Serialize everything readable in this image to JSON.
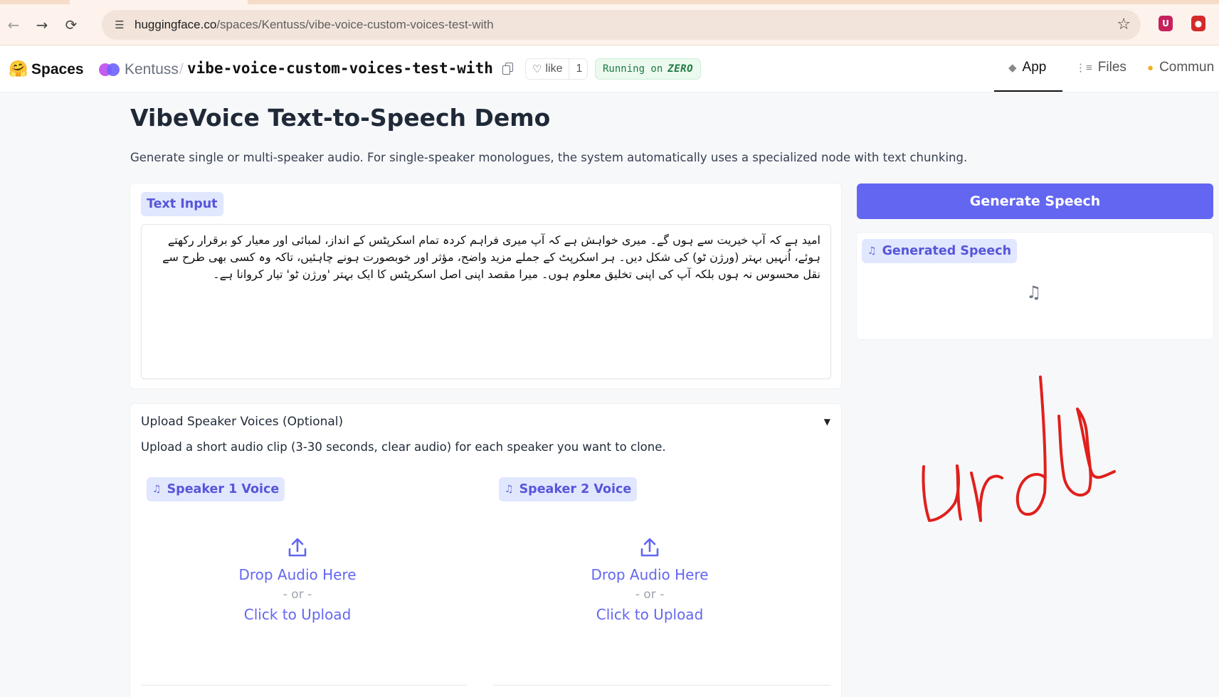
{
  "browser": {
    "url_host": "huggingface.co",
    "url_path": "/spaces/Kentuss/vibe-voice-custom-voices-test-with",
    "back_icon": "arrow-left",
    "forward_icon": "arrow-right",
    "reload_icon": "reload",
    "site_info_icon": "tune",
    "bookmark_icon": "star-outline",
    "extensions": [
      "ublock-shield",
      "security-shield"
    ]
  },
  "header": {
    "spaces_label": "Spaces",
    "owner": "Kentuss",
    "separator": "/",
    "repo": "vibe-voice-custom-voices-test-with",
    "like_label": "like",
    "like_count": "1",
    "running_prefix": "Running on",
    "running_hw": "ZERO",
    "tabs": [
      {
        "label": "App",
        "icon": "cube",
        "active": true
      },
      {
        "label": "Files",
        "icon": "files",
        "active": false
      },
      {
        "label": "Commun",
        "icon": "community",
        "active": false
      }
    ]
  },
  "page": {
    "title": "VibeVoice Text-to-Speech Demo",
    "subtitle": "Generate single or multi-speaker audio. For single-speaker monologues, the system automatically uses a specialized node with text chunking."
  },
  "text_input": {
    "label": "Text Input",
    "value": "امید ہے کہ آپ خیریت سے ہوں گے۔ میری خواہش ہے کہ آپ میری فراہم کردہ تمام اسکرپٹس کے انداز، لمبائی اور معیار کو برقرار رکھتے ہوئے، اُنہیں بہتر (ورژن ٹو) کی شکل دیں۔ ہر اسکرپٹ کے جملے مزید واضح، مؤثر اور خوبصورت ہونے چاہئیں، تاکہ وہ کسی بھی طرح سے نقل محسوس نہ ہوں بلکہ آپ کی اپنی تخلیق معلوم ہوں۔ میرا مقصد اپنی اصل اسکرپٹس کا ایک بہتر 'ورژن ٹو' تیار کروانا ہے۔"
  },
  "generate_button": "Generate Speech",
  "output": {
    "label": "Generated Speech"
  },
  "upload": {
    "title": "Upload Speaker Voices (Optional)",
    "caret": "▼",
    "description": "Upload a short audio clip (3-30 seconds, clear audio) for each speaker you want to clone.",
    "speakers": [
      {
        "label": "Speaker 1 Voice",
        "drop": "Drop Audio Here",
        "or": "- or -",
        "click": "Click to Upload"
      },
      {
        "label": "Speaker 2 Voice",
        "drop": "Drop Audio Here",
        "or": "- or -",
        "click": "Click to Upload"
      }
    ]
  },
  "annotation": {
    "handwritten": "urdu",
    "color": "#e0201c"
  },
  "colors": {
    "accent": "#6366f1",
    "chip_bg": "#e0e7ff",
    "running_green": "#1f7a44"
  }
}
